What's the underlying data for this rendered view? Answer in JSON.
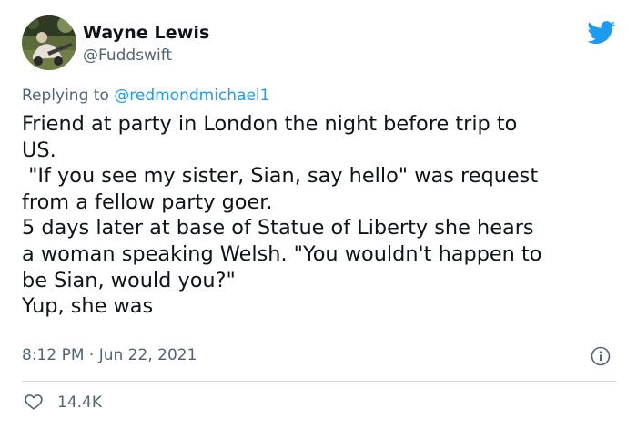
{
  "tweet": {
    "display_name": "Wayne Lewis",
    "handle": "@Fuddswift",
    "replying_prefix": "Replying to ",
    "replying_to": "@redmondmichael1",
    "text": "Friend at party in London the night before trip to\nUS.\n \"If you see my sister, Sian, say hello\" was request\nfrom a fellow party goer.\n5 days later at base of Statue of Liberty she hears\na woman speaking Welsh. \"You wouldn't happen to\nbe Sian, would you?\"\nYup, she was",
    "time": "8:12 PM",
    "separator": " · ",
    "date": "Jun 22, 2021",
    "likes": "14.4K"
  },
  "icons": {
    "brand": "twitter-bird-icon",
    "info": "info-icon",
    "like": "heart-icon"
  },
  "colors": {
    "brand": "#1d9bf0",
    "secondary_text": "#536471",
    "divider": "#cfd9de"
  }
}
